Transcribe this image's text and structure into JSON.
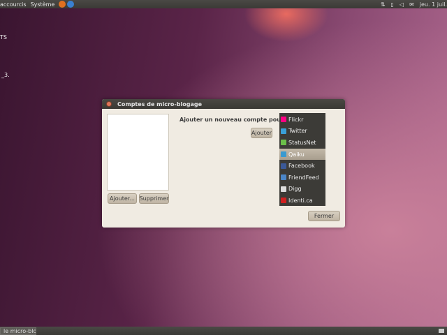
{
  "top_panel": {
    "menus": [
      "accourcis",
      "Système"
    ],
    "icons": [
      "firefox-icon",
      "help-icon"
    ],
    "tray_icons": [
      "network-icon",
      "battery-icon",
      "volume-icon",
      "mail-icon"
    ],
    "clock": "jeu. 1 juil."
  },
  "desktop": {
    "fragments": [
      "TS",
      "_3."
    ]
  },
  "dialog": {
    "title": "Comptes de micro-blogage",
    "add_label": "Ajouter un nouveau compte pour :",
    "add_button": "Ajouter",
    "list_add_button": "Ajouter...",
    "remove_button": "Supprimer",
    "close_button": "Fermer",
    "services": [
      {
        "label": "Flickr",
        "icon": "flickr-icon",
        "color": "#ff0084"
      },
      {
        "label": "Twitter",
        "icon": "twitter-icon",
        "color": "#3aa0d8"
      },
      {
        "label": "StatusNet",
        "icon": "statusnet-icon",
        "color": "#6cc04a"
      },
      {
        "label": "Qaiku",
        "icon": "qaiku-icon",
        "color": "#3a9ad0"
      },
      {
        "label": "Facebook",
        "icon": "facebook-icon",
        "color": "#3b5998"
      },
      {
        "label": "FriendFeed",
        "icon": "friendfeed-icon",
        "color": "#4b86c8"
      },
      {
        "label": "Digg",
        "icon": "digg-icon",
        "color": "#dddddd"
      },
      {
        "label": "Identi.ca",
        "icon": "identica-icon",
        "color": "#d02020"
      }
    ],
    "selected_service": "Qaiku"
  },
  "bottom_panel": {
    "task": "le micro-blo..."
  }
}
